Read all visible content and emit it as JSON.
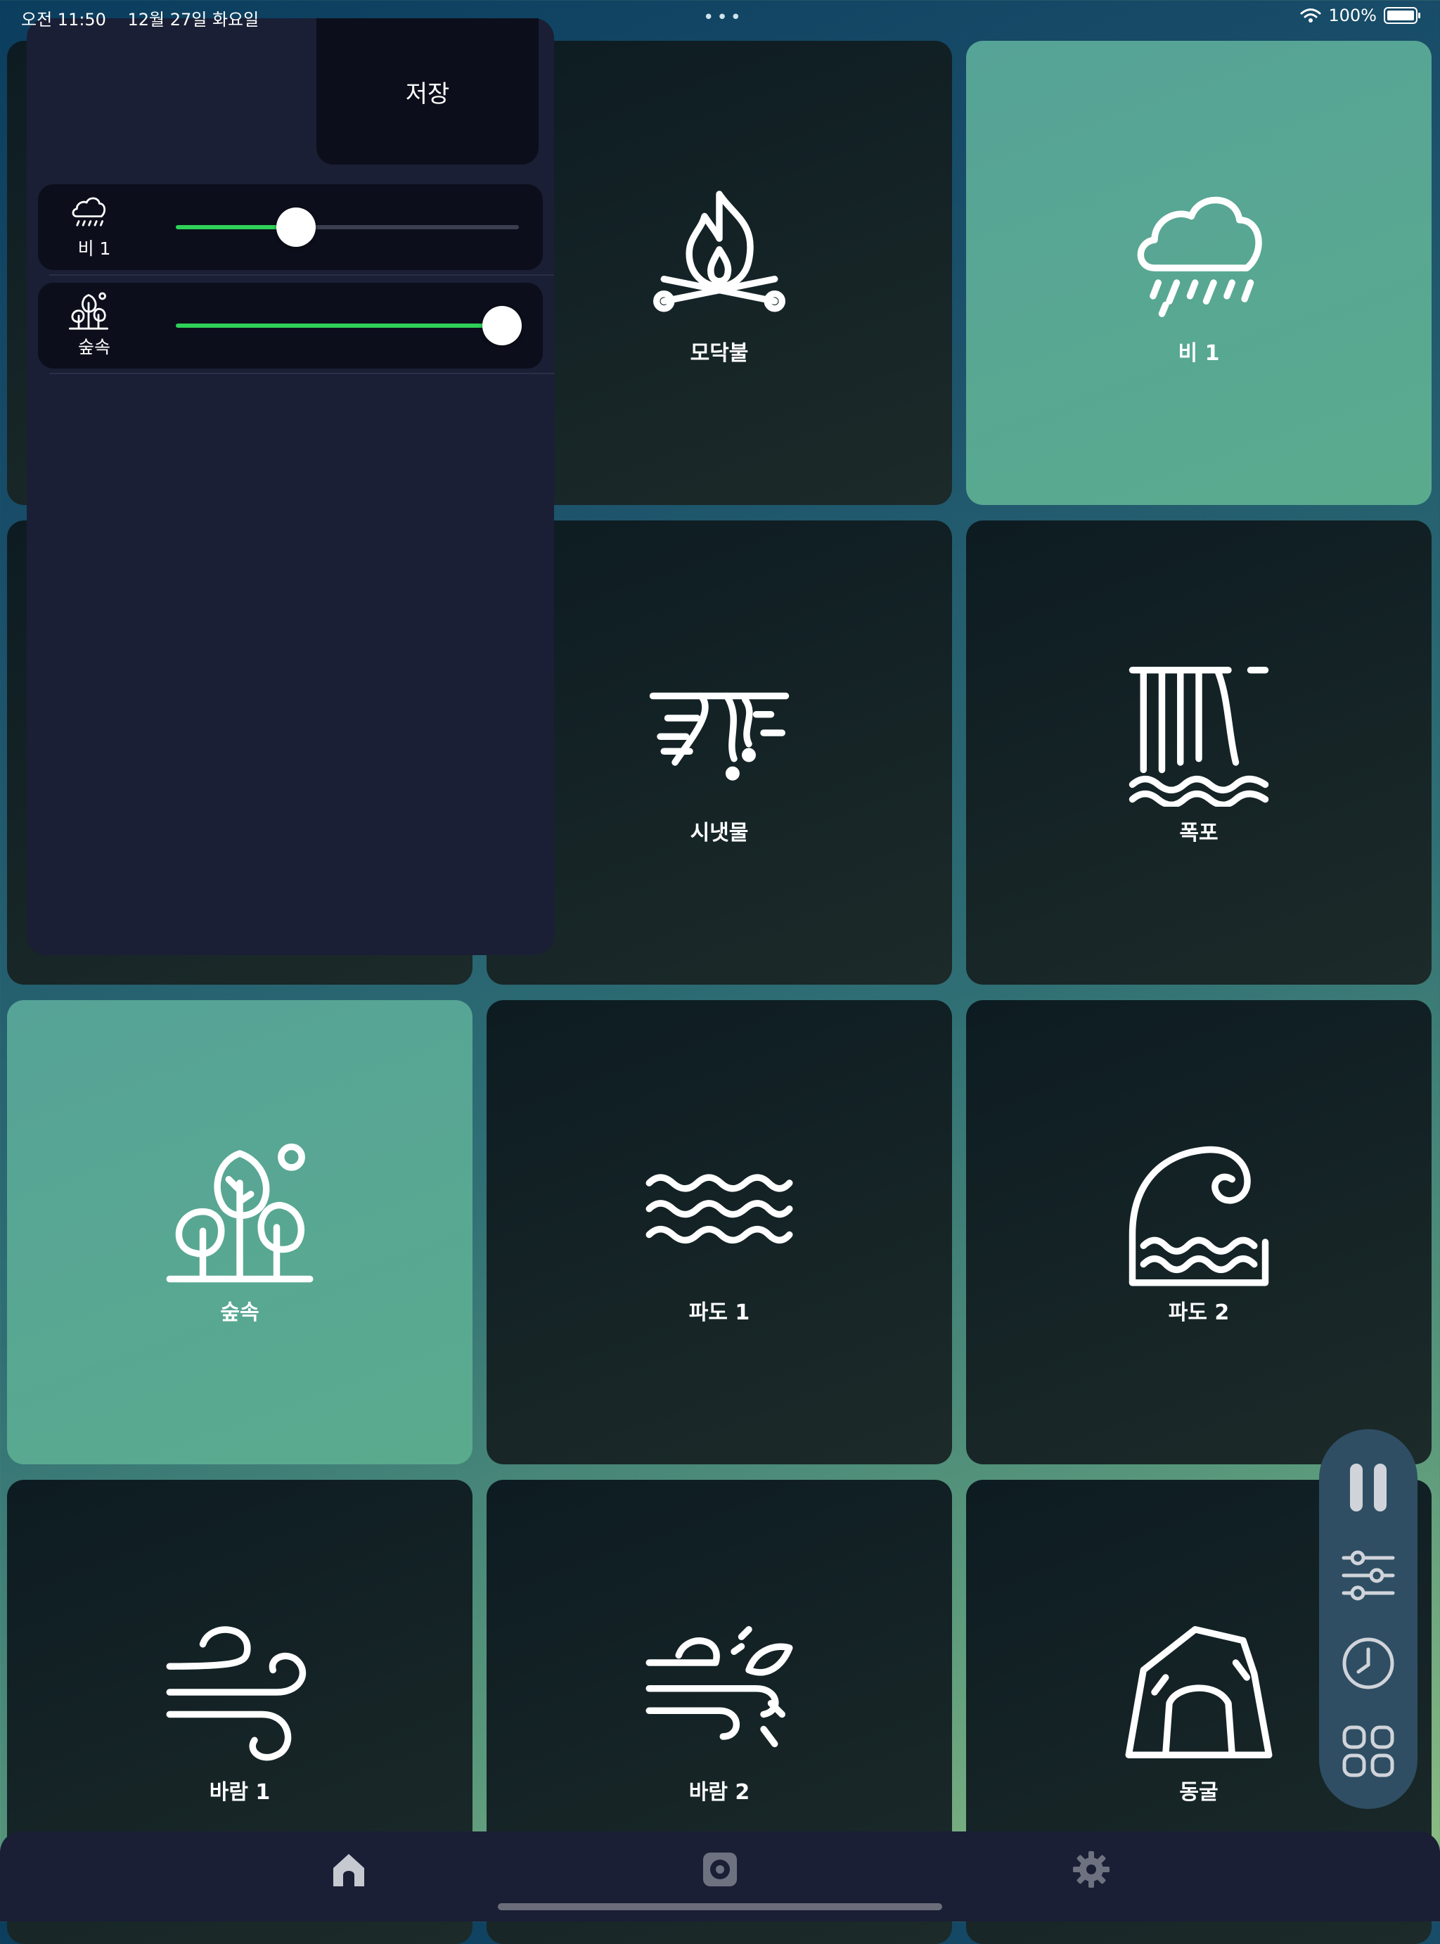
{
  "status_bar": {
    "time": "오전 11:50",
    "date": "12월 27일 화요일",
    "multitask": "•••",
    "battery": "100%"
  },
  "panel": {
    "save_label": "저장",
    "mix": [
      {
        "name": "비 1",
        "icon": "rain-cloud-icon",
        "level": 0.35
      },
      {
        "name": "숲속",
        "icon": "forest-icon",
        "level": 0.95
      }
    ]
  },
  "sounds": [
    {
      "name": "",
      "icon": "",
      "active": false
    },
    {
      "name": "모닥불",
      "icon": "campfire-icon",
      "active": false
    },
    {
      "name": "비 1",
      "icon": "rain-cloud-icon",
      "active": true
    },
    {
      "name": "",
      "icon": "",
      "active": false
    },
    {
      "name": "시냇물",
      "icon": "stream-icon",
      "active": false
    },
    {
      "name": "폭포",
      "icon": "waterfall-icon",
      "active": false
    },
    {
      "name": "숲속",
      "icon": "forest-icon",
      "active": true
    },
    {
      "name": "파도 1",
      "icon": "waves-icon",
      "active": false
    },
    {
      "name": "파도 2",
      "icon": "big-wave-icon",
      "active": false
    },
    {
      "name": "바람 1",
      "icon": "wind-icon",
      "active": false
    },
    {
      "name": "바람 2",
      "icon": "wind-leaf-icon",
      "active": false
    },
    {
      "name": "동굴",
      "icon": "cave-icon",
      "active": false
    }
  ],
  "controls": [
    "pause-icon",
    "sliders-icon",
    "timer-icon",
    "grid-icon"
  ],
  "tabs": [
    "home-icon",
    "record-icon",
    "gear-icon"
  ],
  "colors": {
    "accent_green": "#2fd158",
    "active_tile": "#56a397",
    "panel": "#1a1f35"
  }
}
